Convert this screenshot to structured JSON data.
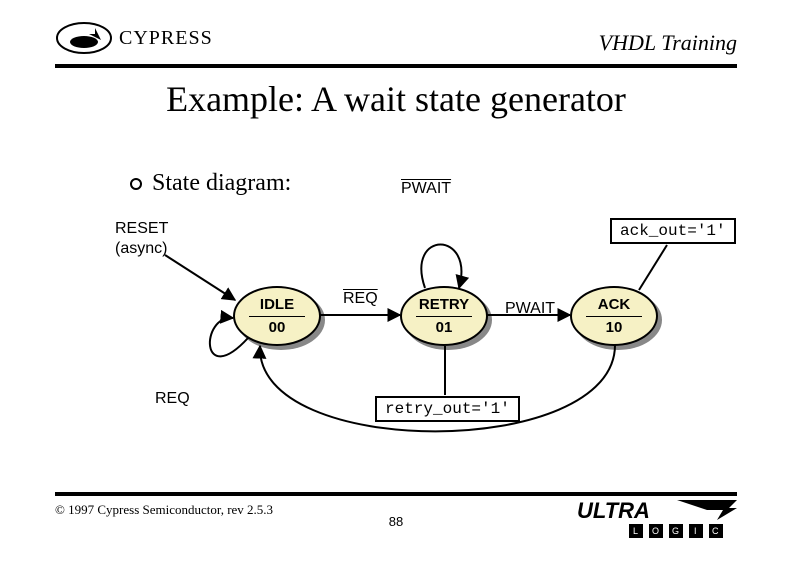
{
  "header": {
    "logo_text": "CYPRESS",
    "title": "VHDL Training"
  },
  "slide_title": "Example: A wait state generator",
  "bullet": {
    "text": "State diagram:"
  },
  "diagram": {
    "labels": {
      "pwait_top": "PWAIT",
      "reset": "RESET",
      "async": "(async)",
      "req_mid": "REQ",
      "pwait_right": "PWAIT",
      "req_bottom": "REQ"
    },
    "outputs": {
      "ack": "ack_out='1'",
      "retry": "retry_out='1'"
    },
    "states": {
      "idle": {
        "name": "IDLE",
        "code": "00"
      },
      "retry": {
        "name": "RETRY",
        "code": "01"
      },
      "ack": {
        "name": "ACK",
        "code": "10"
      }
    }
  },
  "footer": {
    "copyright": "© 1997 Cypress Semiconductor, rev 2.5.3",
    "page": "88",
    "brand_main": "ULTRA",
    "brand_sub": [
      "L",
      "O",
      "G",
      "I",
      "C"
    ]
  },
  "chart_data": {
    "type": "other",
    "title": "Wait state generator — state diagram",
    "kind": "finite-state-machine",
    "encoding": "one-hot/binary state codes shown",
    "states": [
      {
        "id": "IDLE",
        "code": "00",
        "outputs": []
      },
      {
        "id": "RETRY",
        "code": "01",
        "outputs": [
          "retry_out='1'"
        ]
      },
      {
        "id": "ACK",
        "code": "10",
        "outputs": [
          "ack_out='1'"
        ]
      }
    ],
    "transitions": [
      {
        "from": "IDLE",
        "to": "IDLE",
        "condition": "REQ",
        "note": "self-loop"
      },
      {
        "from": "IDLE",
        "to": "RETRY",
        "condition": "REQ (negated)",
        "label_rendered": "REQ with overline"
      },
      {
        "from": "RETRY",
        "to": "RETRY",
        "condition": "PWAIT (negated)",
        "label_rendered": "PWAIT with overline",
        "note": "self-loop"
      },
      {
        "from": "RETRY",
        "to": "ACK",
        "condition": "PWAIT"
      },
      {
        "from": "ACK",
        "to": "IDLE",
        "condition": "",
        "note": "unconditional return"
      },
      {
        "from": "any",
        "to": "IDLE",
        "condition": "RESET (async)"
      }
    ]
  }
}
